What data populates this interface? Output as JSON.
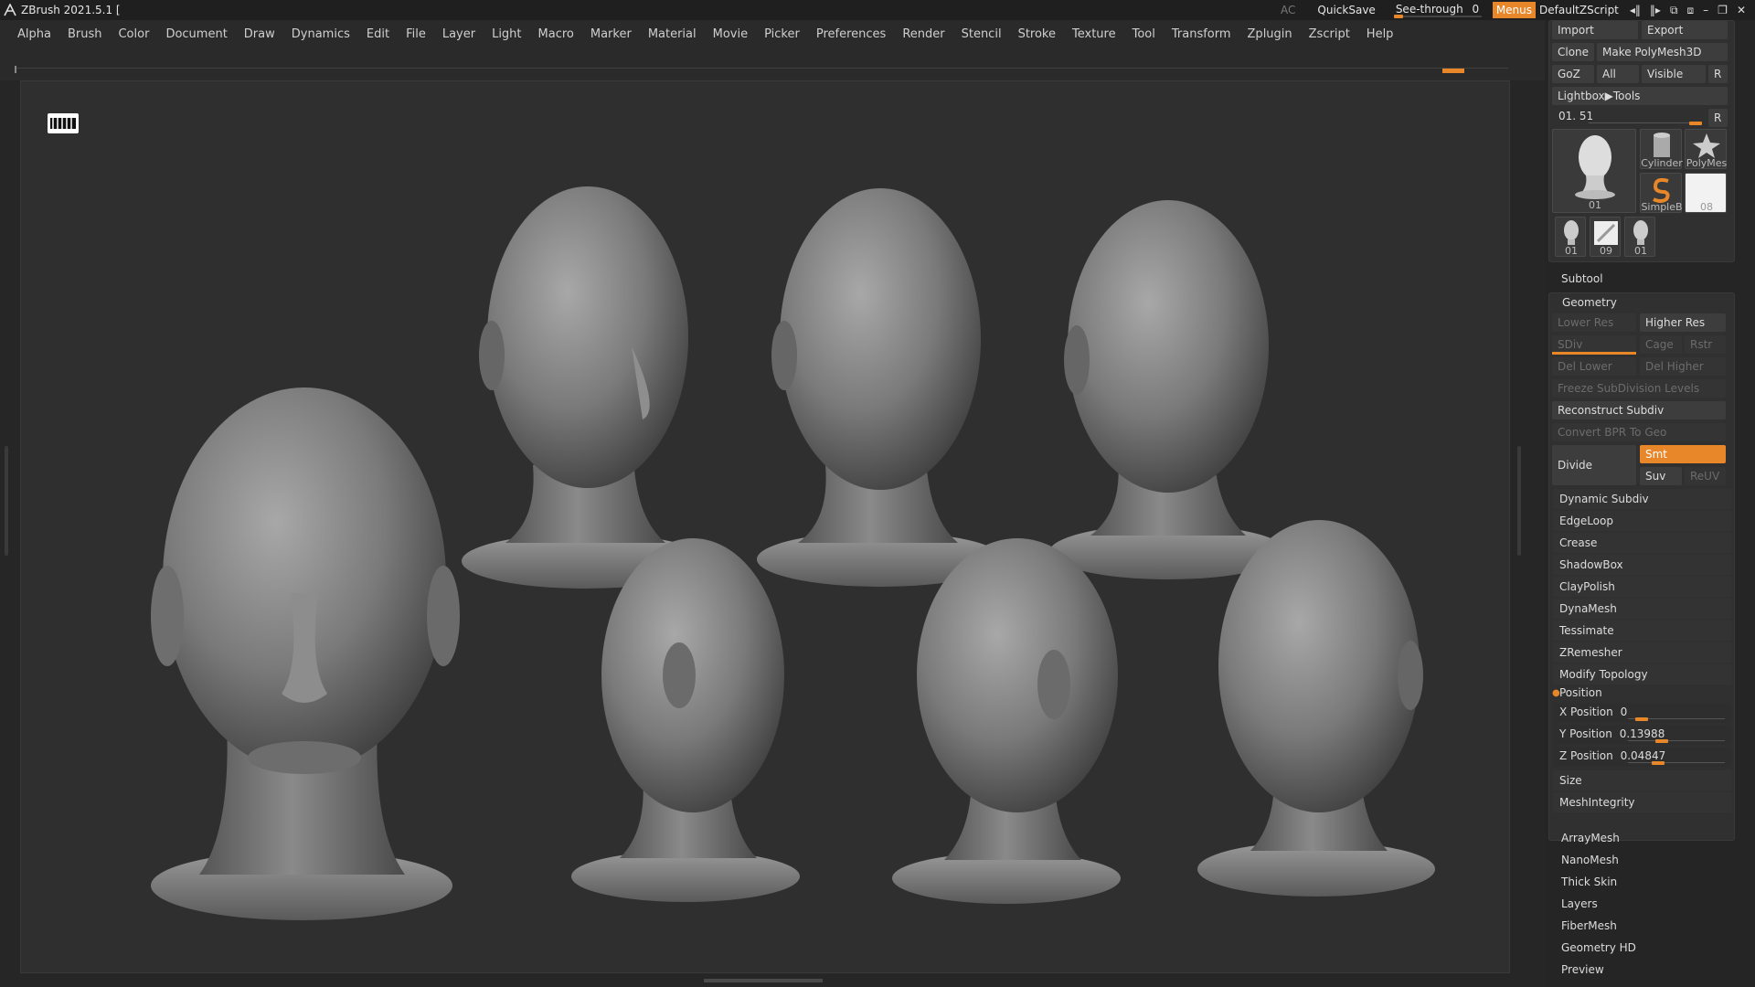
{
  "titlebar": {
    "title": "ZBrush 2021.5.1 [",
    "ac": "AC",
    "quicksave": "QuickSave",
    "see_through_label": "See-through",
    "see_through_value": "0",
    "see_through_fraction": 0,
    "menus": "Menus",
    "default_zscript": "DefaultZScript"
  },
  "menubar": [
    "Alpha",
    "Brush",
    "Color",
    "Document",
    "Draw",
    "Dynamics",
    "Edit",
    "File",
    "Layer",
    "Light",
    "Macro",
    "Marker",
    "Material",
    "Movie",
    "Picker",
    "Preferences",
    "Render",
    "Stencil",
    "Stroke",
    "Texture",
    "Tool",
    "Transform",
    "Zplugin",
    "Zscript",
    "Help"
  ],
  "tool": {
    "import": "Import",
    "export": "Export",
    "clone": "Clone",
    "make_polymesh": "Make PolyMesh3D",
    "goz": "GoZ",
    "all": "All",
    "visible": "Visible",
    "r": "R",
    "lightbox_tools": "Lightbox▶Tools",
    "slider_label": "01. 51",
    "slider_r": "R",
    "thumbs": {
      "main": "01",
      "cylinder": "Cylinder",
      "polymesh": "PolyMes",
      "simpleb": "SimpleB",
      "blank": "08",
      "small1": "01",
      "small2": "09",
      "small3": "01"
    }
  },
  "subtool": "Subtool",
  "geometry": {
    "title": "Geometry",
    "lower_res": "Lower Res",
    "higher_res": "Higher Res",
    "sdiv": "SDiv",
    "cage": "Cage",
    "rstr": "Rstr",
    "del_lower": "Del Lower",
    "del_higher": "Del Higher",
    "freeze": "Freeze SubDivision Levels",
    "reconstruct": "Reconstruct Subdiv",
    "convert_bpr": "Convert BPR To Geo",
    "divide": "Divide",
    "smt": "Smt",
    "suv": "Suv",
    "reuv": "ReUV",
    "sections": [
      "Dynamic Subdiv",
      "EdgeLoop",
      "Crease",
      "ShadowBox",
      "ClayPolish",
      "DynaMesh",
      "Tessimate",
      "ZRemesher",
      "Modify Topology"
    ],
    "position": {
      "title": "Position",
      "x_label": "X Position",
      "x_value": "0",
      "y_label": "Y Position",
      "y_value": "0.13988",
      "z_label": "Z Position",
      "z_value": "0.04847"
    },
    "size": "Size",
    "meshintegrity": "MeshIntegrity"
  },
  "more_menus": [
    "ArrayMesh",
    "NanoMesh",
    "Thick Skin",
    "Layers",
    "FiberMesh",
    "Geometry HD",
    "Preview"
  ],
  "colors": {
    "accent": "#e8862a",
    "panel": "#252525",
    "viewport": "#2f2f2f"
  }
}
